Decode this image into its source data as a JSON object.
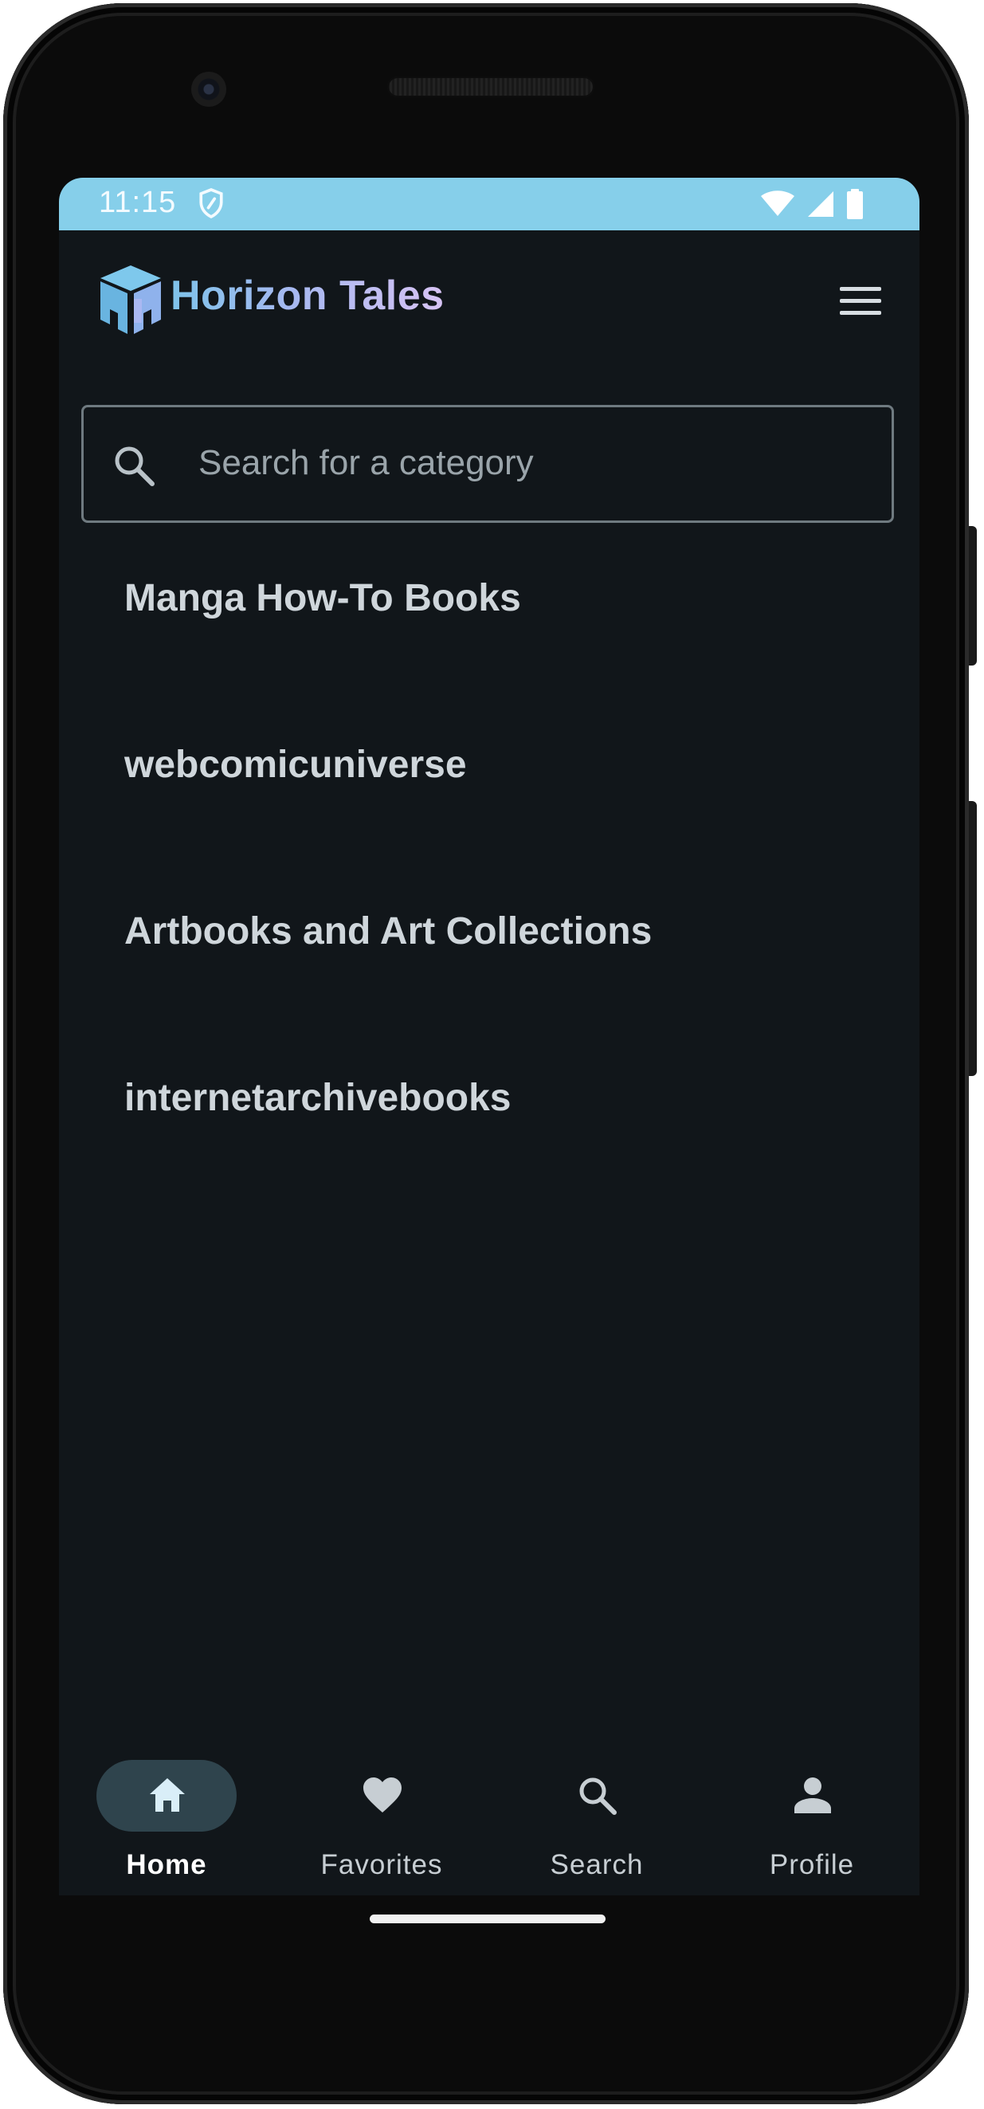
{
  "status_bar": {
    "time": "11:15",
    "color": "#86cfea"
  },
  "header": {
    "brand": "Horizon Tales",
    "logo_icon": "horizon-tales-logo",
    "menu_icon": "hamburger-menu-icon"
  },
  "search": {
    "placeholder": "Search for a category",
    "value": ""
  },
  "categories": [
    {
      "label": "Manga How-To Books"
    },
    {
      "label": "webcomicuniverse"
    },
    {
      "label": "Artbooks and Art Collections"
    },
    {
      "label": "internetarchivebooks"
    }
  ],
  "bottom_nav": {
    "items": [
      {
        "label": "Home",
        "icon": "home-icon",
        "active": true
      },
      {
        "label": "Favorites",
        "icon": "heart-icon",
        "active": false
      },
      {
        "label": "Search",
        "icon": "search-icon",
        "active": false
      },
      {
        "label": "Profile",
        "icon": "person-icon",
        "active": false
      }
    ],
    "active_pill_color": "#2f444d"
  },
  "theme": {
    "background": "#11161a",
    "text": "#cfd6db"
  }
}
